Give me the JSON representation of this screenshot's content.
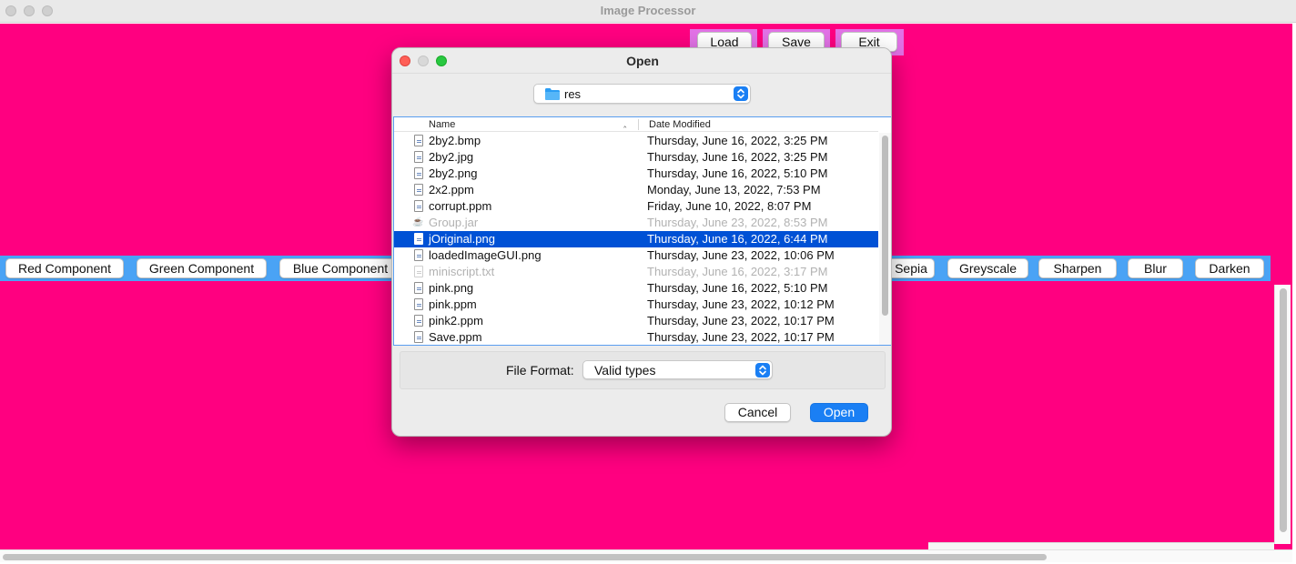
{
  "window": {
    "title": "Image Processor"
  },
  "toolbar": {
    "load": "Load",
    "save": "Save",
    "exit": "Exit"
  },
  "operations": {
    "left": [
      "Red Component",
      "Green Component",
      "Blue Component"
    ],
    "right": [
      "Sepia",
      "Greyscale",
      "Sharpen",
      "Blur",
      "Darken"
    ]
  },
  "colors": {
    "canvas": "#ff0080",
    "strip": "#4aa3f5",
    "toolbar_bg": "#e272e6",
    "selection": "#0051d5",
    "accent": "#1a7ff4"
  },
  "dialog": {
    "title": "Open",
    "location": "res",
    "columns": {
      "name": "Name",
      "date": "Date Modified"
    },
    "files": [
      {
        "name": "2by2.bmp",
        "date": "Thursday, June 16, 2022, 3:25 PM",
        "icon": "document-icon"
      },
      {
        "name": "2by2.jpg",
        "date": "Thursday, June 16, 2022, 3:25 PM",
        "icon": "document-icon"
      },
      {
        "name": "2by2.png",
        "date": "Thursday, June 16, 2022, 5:10 PM",
        "icon": "document-icon"
      },
      {
        "name": "2x2.ppm",
        "date": "Monday, June 13, 2022, 7:53 PM",
        "icon": "document-icon"
      },
      {
        "name": "corrupt.ppm",
        "date": "Friday, June 10, 2022, 8:07 PM",
        "icon": "document-icon"
      },
      {
        "name": "Group.jar",
        "date": "Thursday, June 23, 2022, 8:53 PM",
        "icon": "java-icon",
        "disabled": true
      },
      {
        "name": "jOriginal.png",
        "date": "Thursday, June 16, 2022, 6:44 PM",
        "icon": "document-icon",
        "selected": true
      },
      {
        "name": "loadedImageGUI.png",
        "date": "Thursday, June 23, 2022, 10:06 PM",
        "icon": "document-icon"
      },
      {
        "name": "miniscript.txt",
        "date": "Thursday, June 16, 2022, 3:17 PM",
        "icon": "document-icon",
        "disabled": true
      },
      {
        "name": "pink.png",
        "date": "Thursday, June 16, 2022, 5:10 PM",
        "icon": "document-icon"
      },
      {
        "name": "pink.ppm",
        "date": "Thursday, June 23, 2022, 10:12 PM",
        "icon": "document-icon"
      },
      {
        "name": "pink2.ppm",
        "date": "Thursday, June 23, 2022, 10:17 PM",
        "icon": "document-icon"
      },
      {
        "name": "Save.ppm",
        "date": "Thursday, June 23, 2022, 10:17 PM",
        "icon": "document-icon"
      }
    ],
    "format_label": "File Format:",
    "format_value": "Valid types",
    "cancel": "Cancel",
    "open": "Open"
  }
}
